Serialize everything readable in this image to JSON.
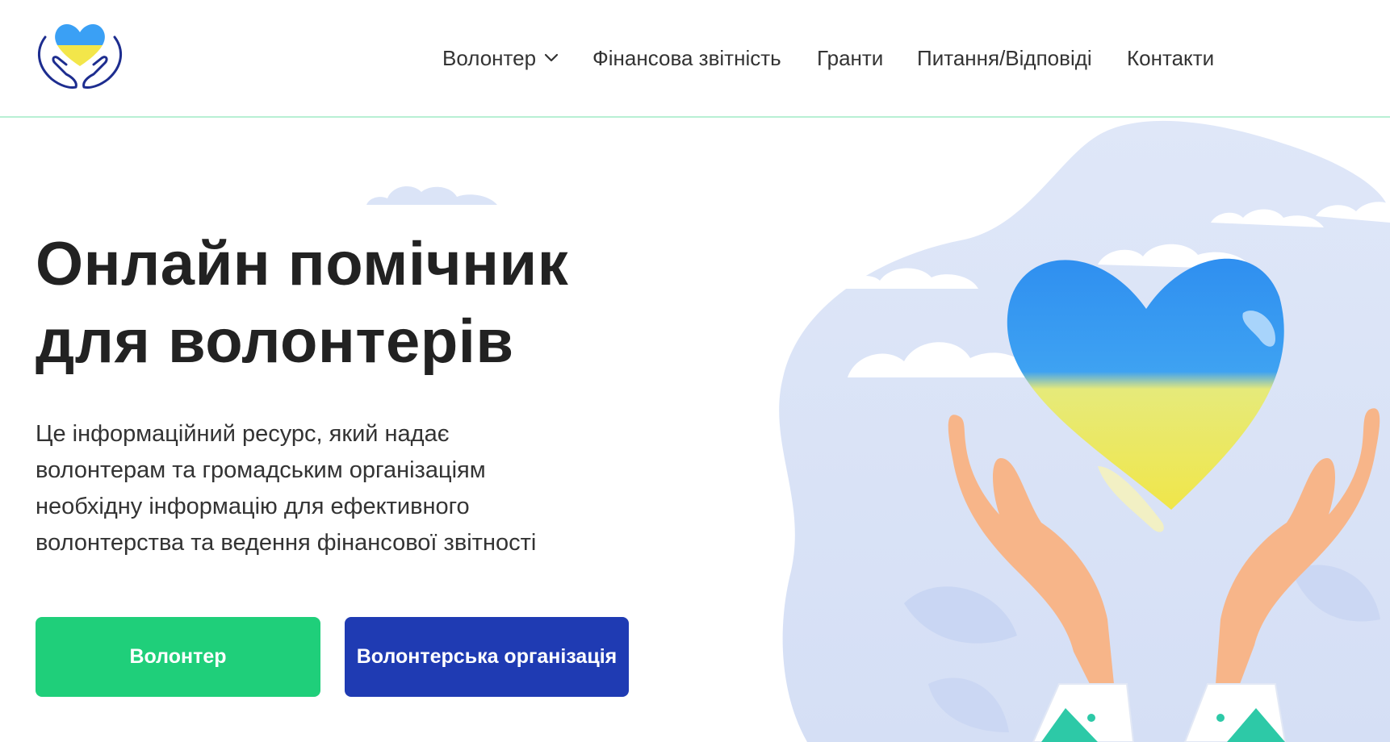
{
  "header": {
    "nav": [
      {
        "label": "Волонтер",
        "has_dropdown": true
      },
      {
        "label": "Фінансова звітність"
      },
      {
        "label": "Гранти"
      },
      {
        "label": "Питання/Відповіді"
      },
      {
        "label": "Контакти"
      }
    ]
  },
  "hero": {
    "title_line1": "Онлайн помічник",
    "title_line2": "для волонтерів",
    "description_lines": [
      "Це інформаційний ресурс, який надає",
      "волонтерам та громадським організаціям",
      "необхідну інформацію для ефективного",
      "волонтерства та ведення фінансової звітності"
    ],
    "buttons": {
      "volunteer": "Волонтер",
      "organization": "Волонтерська організація"
    }
  },
  "colors": {
    "accent_green": "#1fcf7a",
    "accent_blue": "#1f3bb3",
    "flag_blue": "#2f8fef",
    "flag_yellow": "#f2e84a"
  },
  "icons": {
    "logo": "heart-in-hands-icon",
    "dropdown": "chevron-down-icon"
  }
}
